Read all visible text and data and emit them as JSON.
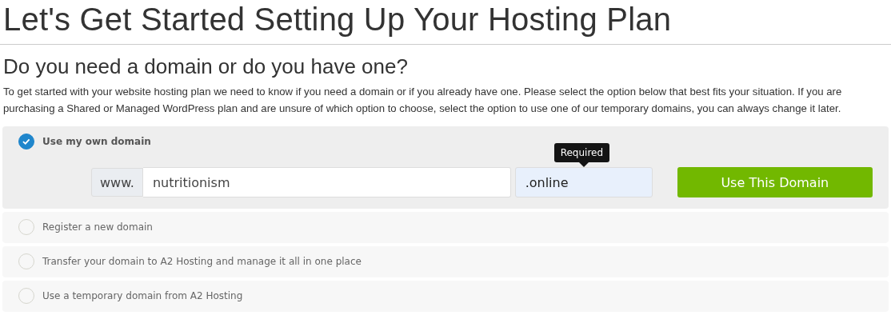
{
  "title": "Let's Get Started Setting Up Your Hosting Plan",
  "heading": "Do you need a domain or do you have one?",
  "intro": "To get started with your website hosting plan we need to know if you need a domain or if you already have one. Please select the option below that best fits your situation. If you are purchasing a Shared or Managed WordPress plan and are unsure of which option to choose, select the option to use one of our temporary domains, you can always change it later.",
  "options": [
    {
      "label": "Use my own domain",
      "selected": true,
      "form": {
        "prefix": "www.",
        "domain": "nutritionism",
        "tld": ".online",
        "tooltip": "Required",
        "button": "Use This Domain"
      }
    },
    {
      "label": "Register a new domain",
      "selected": false
    },
    {
      "label": "Transfer your domain to A2 Hosting and manage it all in one place",
      "selected": false
    },
    {
      "label": "Use a temporary domain from A2 Hosting",
      "selected": false
    }
  ]
}
